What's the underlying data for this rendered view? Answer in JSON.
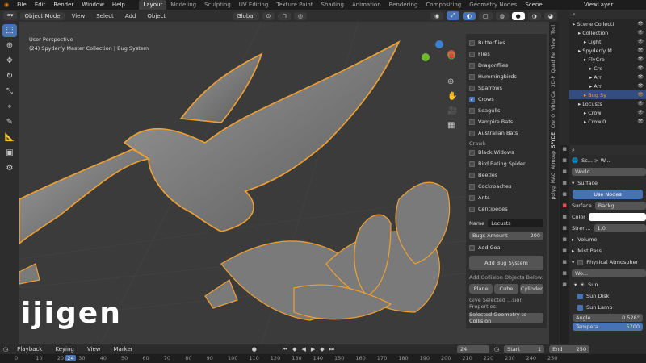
{
  "topbar": {
    "menus": [
      "File",
      "Edit",
      "Render",
      "Window",
      "Help"
    ],
    "workspaces": [
      "Layout",
      "Modeling",
      "Sculpting",
      "UV Editing",
      "Texture Paint",
      "Shading",
      "Animation",
      "Rendering",
      "Compositing",
      "Geometry Nodes"
    ],
    "active_workspace": "Layout",
    "scene": "Scene",
    "view_layer": "ViewLayer"
  },
  "header": {
    "mode": "Object Mode",
    "menus": [
      "View",
      "Select",
      "Add",
      "Object"
    ],
    "orientation": "Global"
  },
  "viewport": {
    "perspective": "User Perspective",
    "collection": "(24) Spyderfy Master Collection | Bug System"
  },
  "npanel": {
    "fly_items": [
      {
        "label": "Butterflies",
        "checked": false
      },
      {
        "label": "Flies",
        "checked": false
      },
      {
        "label": "Dragonflies",
        "checked": false
      },
      {
        "label": "Hummingbirds",
        "checked": false
      },
      {
        "label": "Sparrows",
        "checked": false
      },
      {
        "label": "Crows",
        "checked": true
      },
      {
        "label": "Seagulls",
        "checked": false
      },
      {
        "label": "Vampire Bats",
        "checked": false
      },
      {
        "label": "Australian Bats",
        "checked": false
      }
    ],
    "crawl_label": "Crawl:",
    "crawl_items": [
      {
        "label": "Black Widows",
        "checked": false
      },
      {
        "label": "Bird Eating Spider",
        "checked": false
      },
      {
        "label": "Beetles",
        "checked": false
      },
      {
        "label": "Cockroaches",
        "checked": false
      },
      {
        "label": "Ants",
        "checked": false
      },
      {
        "label": "Centipedes",
        "checked": false
      }
    ],
    "name_label": "Name",
    "name_value": "Locusts",
    "bugs_amount_label": "Bugs Amount",
    "bugs_amount_value": "200",
    "add_goal": "Add Goal",
    "add_bug_system": "Add Bug System",
    "collision_label": "Add Collision Objects Below:",
    "collision_buttons": [
      "Plane",
      "Cube",
      "Cylinder"
    ],
    "give_label": "Give Selected ...sion Properties:",
    "selected_geo": "Selected Geometry to Collision"
  },
  "vtabs": [
    "Tool",
    "View",
    "Quad Re",
    "3D-P",
    "Virtu Ca",
    "O",
    "Cre",
    "SPYDE",
    "Atmosp",
    "MAC",
    "polyg"
  ],
  "outliner": {
    "search_placeholder": "",
    "rows": [
      {
        "label": "Scene Collecti",
        "indent": 0
      },
      {
        "label": "Collection",
        "indent": 1
      },
      {
        "label": "Light",
        "indent": 2
      },
      {
        "label": "Spyderfy M",
        "indent": 1
      },
      {
        "label": "FlyCro",
        "indent": 2
      },
      {
        "label": "Cro",
        "indent": 3
      },
      {
        "label": "Arr",
        "indent": 3
      },
      {
        "label": "Arr",
        "indent": 3
      },
      {
        "label": "Bug Sy",
        "indent": 2
      },
      {
        "label": "Locusts",
        "indent": 1
      },
      {
        "label": "Crow",
        "indent": 2
      },
      {
        "label": "Crow.0",
        "indent": 2
      }
    ]
  },
  "properties": {
    "breadcrumb": "Sc... > W...",
    "world_name": "World",
    "surface_header": "Surface",
    "use_nodes": "Use Nodes",
    "surface_label": "Surface",
    "surface_value": "Backg...",
    "color_label": "Color",
    "strength_label": "Stren...",
    "strength_value": "1.0",
    "volume": "Volume",
    "mist": "Mist Pass",
    "atmos": "Physical Atmospher",
    "wo": "Wo...",
    "sun": "Sun",
    "sun_disk": "Sun Disk",
    "sun_lamp": "Sun Lamp",
    "angle_label": "Angle",
    "angle_value": "0.526°",
    "temp_label": "Tempera",
    "temp_value": "5700"
  },
  "timeline": {
    "menus": [
      "Playback",
      "Keying",
      "View",
      "Marker"
    ],
    "current_frame": "24",
    "start_label": "Start",
    "start_value": "1",
    "end_label": "End",
    "end_value": "250",
    "ticks": [
      "0",
      "10",
      "20",
      "24",
      "30",
      "40",
      "50",
      "60",
      "70",
      "80",
      "90",
      "100",
      "110",
      "120",
      "130",
      "140",
      "150",
      "160",
      "170",
      "180",
      "190",
      "200",
      "210",
      "220",
      "230",
      "240",
      "250"
    ]
  },
  "logo": "ijigen",
  "colors": {
    "accent": "#4772b3",
    "outline": "#f0a030",
    "bg": "#3b3b3b"
  }
}
